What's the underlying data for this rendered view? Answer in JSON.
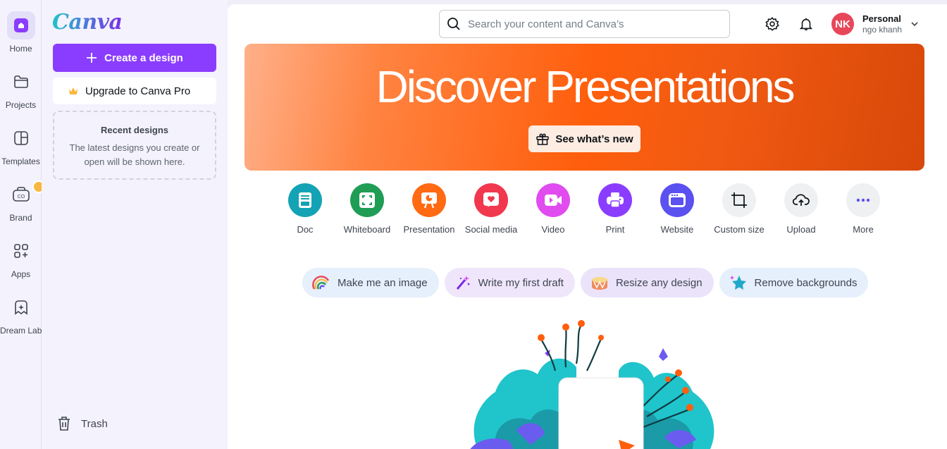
{
  "rail": {
    "items": [
      {
        "label": "Home"
      },
      {
        "label": "Projects"
      },
      {
        "label": "Templates"
      },
      {
        "label": "Brand"
      },
      {
        "label": "Apps"
      },
      {
        "label": "Dream Lab"
      }
    ]
  },
  "panel": {
    "logo": "Canva",
    "create_label": "Create a design",
    "upgrade_label": "Upgrade to Canva Pro",
    "recent_title": "Recent designs",
    "recent_desc": "The latest designs you create or open will be shown here.",
    "trash_label": "Trash"
  },
  "header": {
    "search_placeholder": "Search your content and Canva’s",
    "avatar_initials": "NK",
    "account_type": "Personal",
    "account_name": "ngo khanh"
  },
  "hero": {
    "title": "Discover Presentations",
    "button_label": "See what’s new"
  },
  "design_types": [
    {
      "label": "Doc",
      "color": "#13a3b5"
    },
    {
      "label": "Whiteboard",
      "color": "#1f9d55"
    },
    {
      "label": "Presentation",
      "color": "#ff6a13"
    },
    {
      "label": "Social media",
      "color": "#f1384f"
    },
    {
      "label": "Video",
      "color": "#e04cf0"
    },
    {
      "label": "Print",
      "color": "#8b3dff"
    },
    {
      "label": "Website",
      "color": "#5b50f0"
    },
    {
      "label": "Custom size",
      "color": "#eef0f2"
    },
    {
      "label": "Upload",
      "color": "#eef0f2"
    },
    {
      "label": "More",
      "color": "#eef0f2"
    }
  ],
  "chips": [
    {
      "label": "Make me an image",
      "bg": "#e6effc"
    },
    {
      "label": "Write my first draft",
      "bg": "#efe6fb"
    },
    {
      "label": "Resize any design",
      "bg": "#ebe3fa"
    },
    {
      "label": "Remove backgrounds",
      "bg": "#e6effc"
    }
  ],
  "help_label": "?"
}
